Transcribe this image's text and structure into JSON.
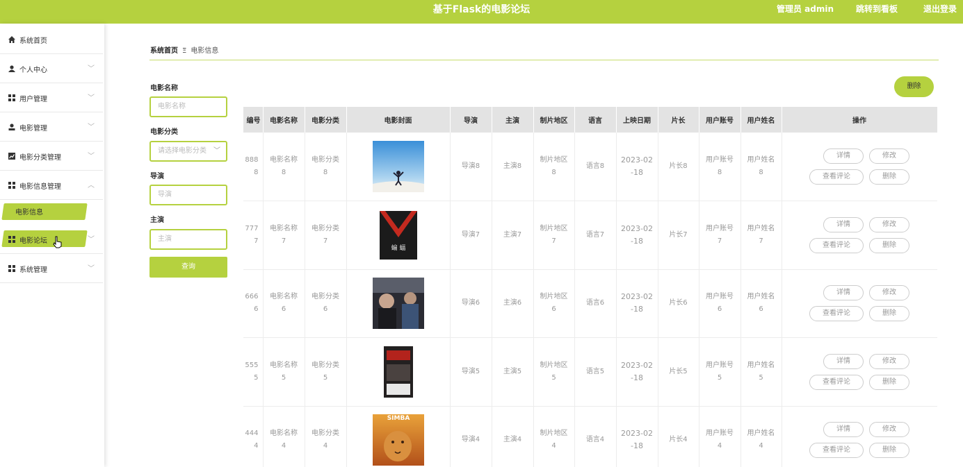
{
  "header": {
    "title": "基于Flask的电影论坛",
    "admin": "管理员 admin",
    "jump": "跳转到看板",
    "logout": "退出登录"
  },
  "sidebar": {
    "items": [
      {
        "label": "系统首页",
        "icon": "home-icon"
      },
      {
        "label": "个人中心",
        "icon": "user-icon"
      },
      {
        "label": "用户管理",
        "icon": "grid-icon"
      },
      {
        "label": "电影管理",
        "icon": "user-icon"
      },
      {
        "label": "电影分类管理",
        "icon": "chart-icon"
      },
      {
        "label": "电影信息管理",
        "icon": "grid-icon"
      },
      {
        "label": "电影论坛",
        "icon": "grid-icon"
      },
      {
        "label": "系统管理",
        "icon": "grid-icon"
      }
    ],
    "sub_item": "电影信息"
  },
  "breadcrumb": {
    "home": "系统首页",
    "sep": "Ξ",
    "current": "电影信息"
  },
  "filters": {
    "name_label": "电影名称",
    "name_placeholder": "电影名称",
    "category_label": "电影分类",
    "category_placeholder": "请选择电影分类",
    "director_label": "导演",
    "director_placeholder": "导演",
    "actor_label": "主演",
    "actor_placeholder": "主演",
    "query": "查询"
  },
  "delete_button": "删除",
  "table": {
    "headers": [
      "编号",
      "电影名称",
      "电影分类",
      "电影封面",
      "导演",
      "主演",
      "制片地区",
      "语言",
      "上映日期",
      "片长",
      "用户账号",
      "用户姓名",
      "操作"
    ],
    "rows": [
      {
        "id": "888\n8",
        "name": "电影名称\n8",
        "cat": "电影分类\n8",
        "director": "导演8",
        "actor": "主演8",
        "region": "制片地区\n8",
        "lang": "语言8",
        "date": "2023-02\n-18",
        "len": "片长8",
        "acct": "用户账号\n8",
        "uname": "用户姓名\n8"
      },
      {
        "id": "777\n7",
        "name": "电影名称\n7",
        "cat": "电影分类\n7",
        "director": "导演7",
        "actor": "主演7",
        "region": "制片地区\n7",
        "lang": "语言7",
        "date": "2023-02\n-18",
        "len": "片长7",
        "acct": "用户账号\n7",
        "uname": "用户姓名\n7"
      },
      {
        "id": "666\n6",
        "name": "电影名称\n6",
        "cat": "电影分类\n6",
        "director": "导演6",
        "actor": "主演6",
        "region": "制片地区\n6",
        "lang": "语言6",
        "date": "2023-02\n-18",
        "len": "片长6",
        "acct": "用户账号\n6",
        "uname": "用户姓名\n6"
      },
      {
        "id": "555\n5",
        "name": "电影名称\n5",
        "cat": "电影分类\n5",
        "director": "导演5",
        "actor": "主演5",
        "region": "制片地区\n5",
        "lang": "语言5",
        "date": "2023-02\n-18",
        "len": "片长5",
        "acct": "用户账号\n5",
        "uname": "用户姓名\n5"
      },
      {
        "id": "444\n4",
        "name": "电影名称\n4",
        "cat": "电影分类\n4",
        "director": "导演4",
        "actor": "主演4",
        "region": "制片地区\n4",
        "lang": "语言4",
        "date": "2023-02\n-18",
        "len": "片长4",
        "acct": "用户账号\n4",
        "uname": "用户姓名\n4"
      }
    ],
    "ops": {
      "detail": "详情",
      "edit": "修改",
      "comments": "查看评论",
      "delete": "删除"
    }
  },
  "colors": {
    "accent": "#b5d13f"
  }
}
